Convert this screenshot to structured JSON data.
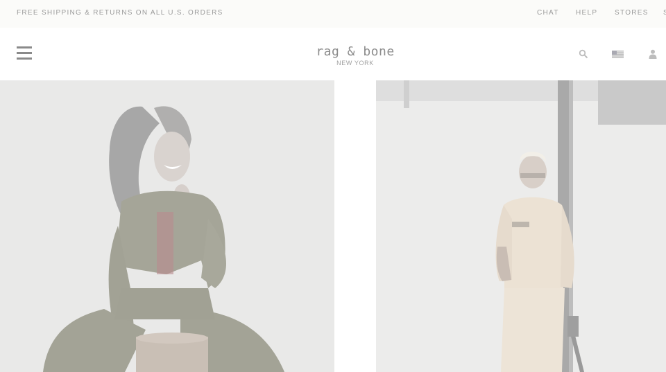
{
  "promo": {
    "text": "FREE SHIPPING & RETURNS ON ALL U.S. ORDERS"
  },
  "utility_nav": {
    "chat": "CHAT",
    "help": "HELP",
    "stores": "STORES",
    "cut": "S"
  },
  "header": {
    "logo_main": "rag & bone",
    "logo_sub": "NEW YORK",
    "icons": [
      "menu-icon",
      "search-icon",
      "us-flag-icon",
      "account-icon"
    ]
  },
  "hero": {
    "left_image": "woman-in-olive-jacket-laughing",
    "right_image": "man-in-cream-shirt-with-camera"
  },
  "colors": {
    "promo_bg": "#fbfbf9",
    "text_muted": "#9a9a9a",
    "image_bg": "#ebebea"
  }
}
